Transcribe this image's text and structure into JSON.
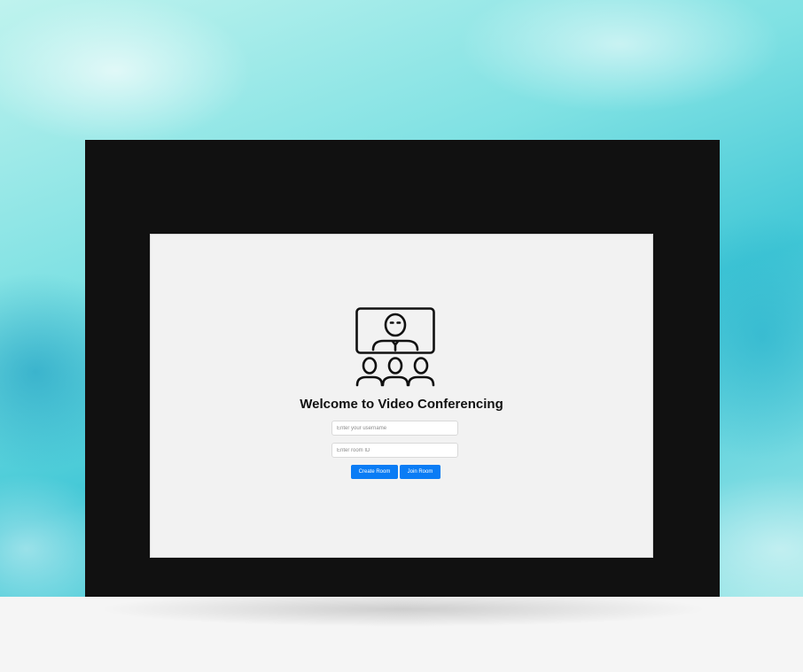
{
  "app": {
    "title": "Welcome to Video Conferencing"
  },
  "hero": {
    "icon": "video-conference-icon"
  },
  "form": {
    "username": {
      "value": "",
      "placeholder": "Enter your username"
    },
    "room_id": {
      "value": "",
      "placeholder": "Enter room ID"
    },
    "create_label": "Create Room",
    "join_label": "Join Room"
  },
  "colors": {
    "primary_button": "#0a7cf5",
    "screen_background": "#f2f2f2",
    "frame": "#111111"
  }
}
